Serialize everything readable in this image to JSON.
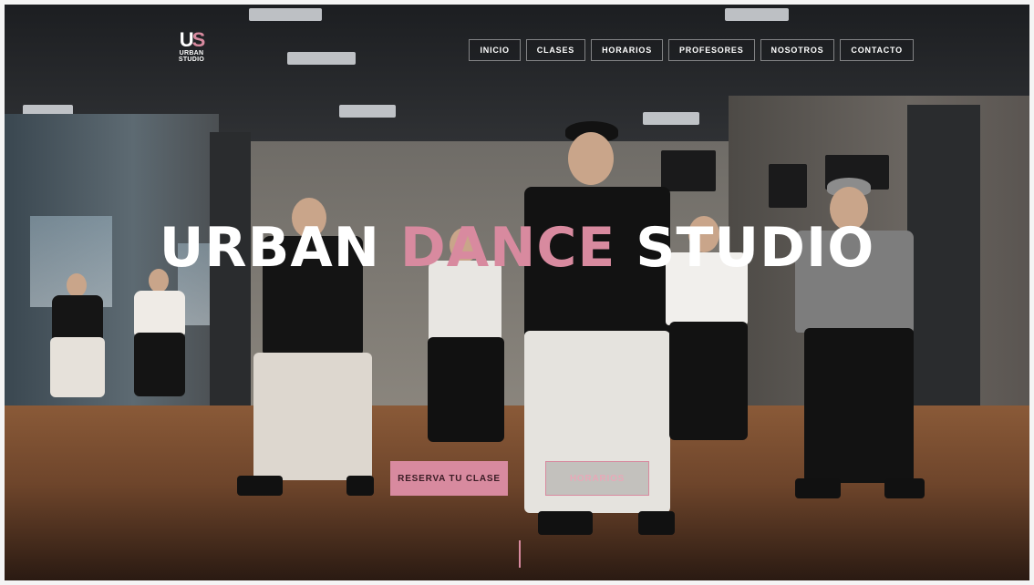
{
  "logo": {
    "mark_left": "U",
    "mark_right": "S",
    "line1": "URBAN",
    "line2": "STUDIO"
  },
  "nav": {
    "items": [
      {
        "label": "INICIO"
      },
      {
        "label": "CLASES"
      },
      {
        "label": "HORARIOS"
      },
      {
        "label": "PROFESORES"
      },
      {
        "label": "NOSOTROS"
      },
      {
        "label": "CONTACTO"
      }
    ]
  },
  "hero": {
    "title_part1": "URBAN",
    "title_accent": "DANCE",
    "title_part2": "STUDIO",
    "primary_cta": "RESERVA TU CLASE",
    "secondary_cta": "HORARIOS"
  },
  "colors": {
    "accent": "#d88a9f",
    "text": "#ffffff"
  }
}
